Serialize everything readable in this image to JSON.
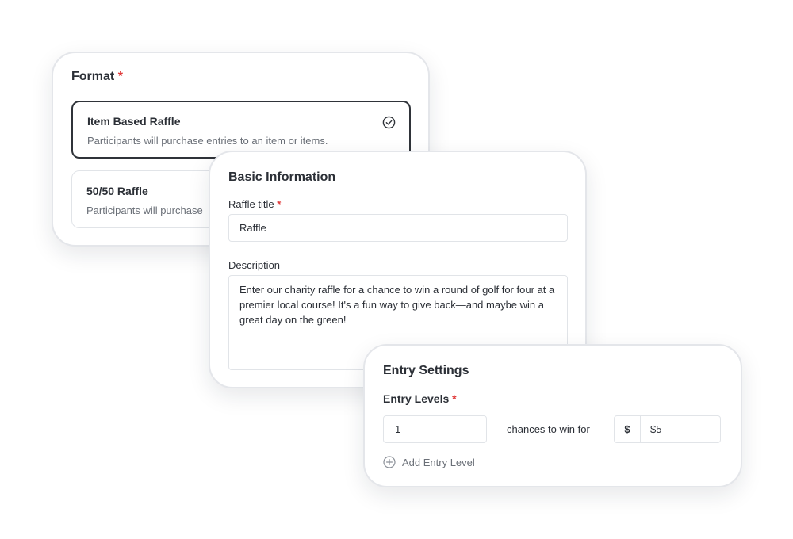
{
  "format": {
    "title": "Format",
    "required_mark": "*",
    "options": [
      {
        "title": "Item Based Raffle",
        "description": "Participants will purchase entries to an item or items.",
        "selected": true
      },
      {
        "title": "50/50 Raffle",
        "description": "Participants will purchase",
        "selected": false
      }
    ]
  },
  "basic_info": {
    "title": "Basic Information",
    "raffle_title_label": "Raffle title",
    "required_mark": "*",
    "raffle_title_value": "Raffle",
    "description_label": "Description",
    "description_value": "Enter our charity raffle for a chance to win a round of golf for four at a premier local course! It's a fun way to give back—and maybe win a great day on the green!"
  },
  "entry_settings": {
    "title": "Entry Settings",
    "levels_label": "Entry Levels",
    "required_mark": "*",
    "quantity_value": "1",
    "chances_text": "chances to win for",
    "currency_symbol": "$",
    "price_value": "$5",
    "add_level_label": "Add Entry Level"
  },
  "icons": {
    "selected_check": "check-circle-icon",
    "add_level": "plus-circle-icon"
  },
  "colors": {
    "required": "#e03b3b",
    "selected_border": "#2f3339",
    "border": "#e1e4e8"
  }
}
